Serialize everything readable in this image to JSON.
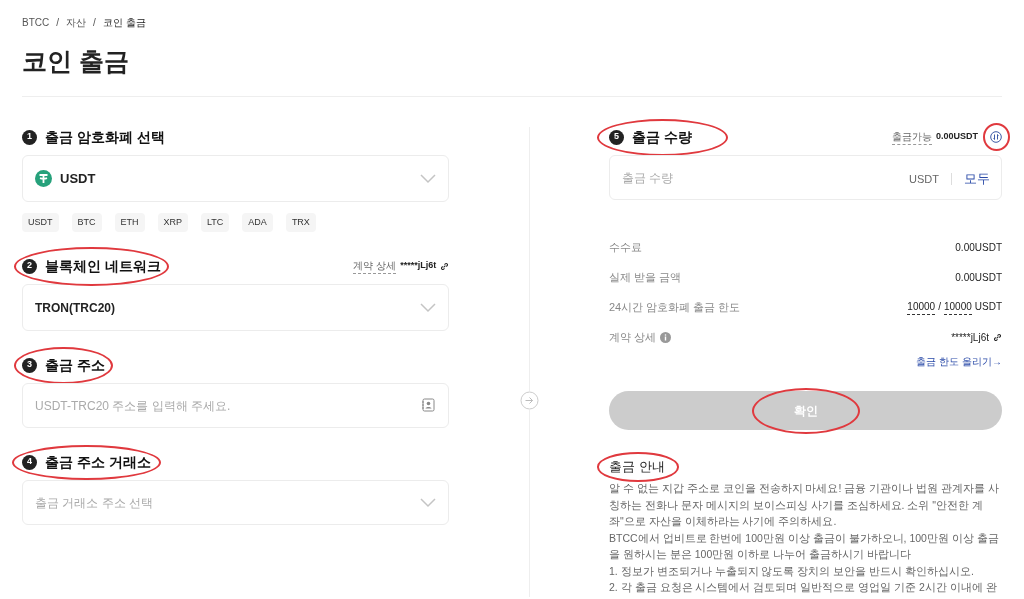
{
  "breadcrumb": [
    "BTCC",
    "/",
    "자산",
    "/",
    "코인 출금"
  ],
  "title": "코인 출금",
  "steps": [
    {
      "number": "1",
      "label": "출금 암호화폐 선택",
      "kind": "coin",
      "value": "USDT",
      "chips": [
        "USDT",
        "BTC",
        "ETH",
        "XRP",
        "LTC",
        "ADA",
        "TRX"
      ]
    },
    {
      "number": "2",
      "label": "블록체인 네트워크",
      "kind": "network",
      "value": "TRON(TRC20)",
      "contract_label": "계약 상세",
      "contract_value": "*****jLj6t"
    },
    {
      "number": "3",
      "label": "출금 주소",
      "kind": "address",
      "placeholder": "USDT-TRC20 주소를 입력해 주세요."
    },
    {
      "number": "4",
      "label": "출금 주소 거래소",
      "kind": "exchange",
      "placeholder": "출금 거래소 주소 선택"
    }
  ],
  "amount": {
    "number": "5",
    "label": "출금 수량",
    "available_label": "출금가능",
    "available_value": "0.00USDT",
    "placeholder": "출금 수량",
    "unit": "USDT",
    "all_button": "모두"
  },
  "details": [
    {
      "label": "수수료",
      "kind": "plain",
      "value": "0.00USDT"
    },
    {
      "label": "실제 받을 금액",
      "kind": "plain",
      "value": "0.00USDT"
    },
    {
      "label": "24시간 암호화폐 출금 한도",
      "kind": "limit",
      "used": "10000",
      "sep": "/",
      "total": "10000",
      "unit": "USDT"
    },
    {
      "label": "계약 상세",
      "kind": "contract",
      "value": "*****jLj6t"
    }
  ],
  "raise_limit_link": "출금 한도 올리기→",
  "confirm_button": {
    "label": "확인",
    "disabled": true
  },
  "notice": {
    "title": "출금 안내",
    "paragraphs": [
      "알 수 없는 지갑 주소로 코인을 전송하지 마세요! 금융 기관이나 법원 관계자를 사칭하는 전화나 문자 메시지의 보이스피싱 사기를 조심하세요. 소위 \"안전한 계좌\"으로 자산을 이체하라는 사기에 주의하세요.",
      "BTCC에서 업비트로 한번에 100만원 이상 출금이 불가하오니, 100만원 이상 출금을 원하시는 분은 100만원 이하로 나누어 출금하시기 바랍니다",
      "1. 정보가 변조되거나 누출되지 않도록 장치의 보안을 반드시 확인하십시오.",
      "2. 각 출금 요청은 시스템에서 검토되며 일반적으로 영업일 기준 2시간 이내에 완"
    ]
  }
}
